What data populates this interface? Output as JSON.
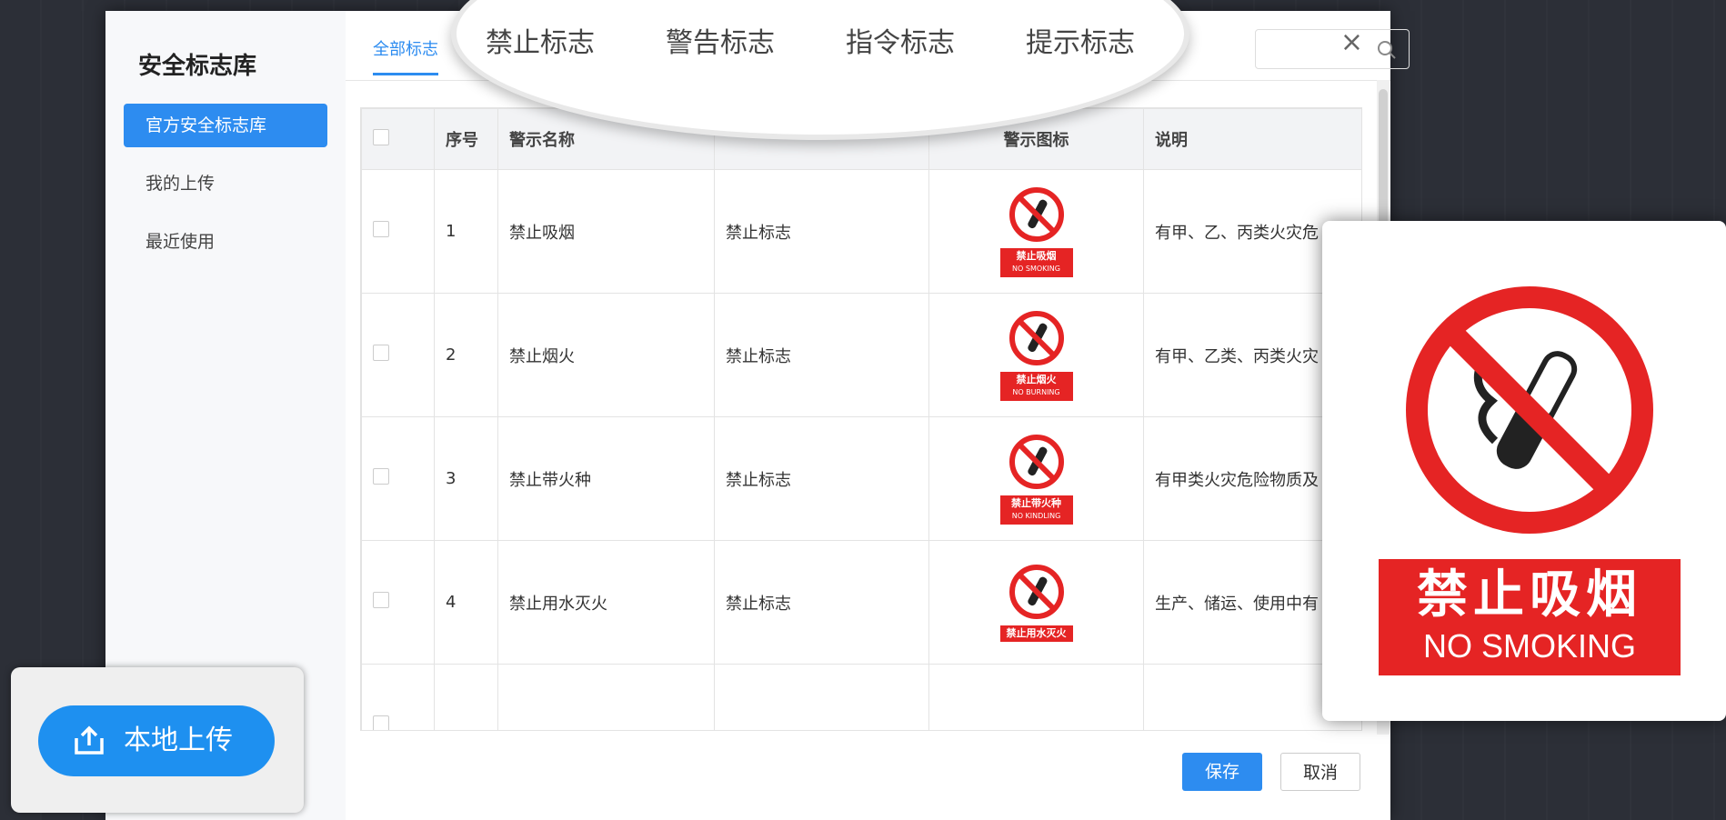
{
  "sidebar": {
    "title": "安全标志库",
    "items": [
      {
        "label": "官方安全标志库",
        "active": true
      },
      {
        "label": "我的上传",
        "active": false
      },
      {
        "label": "最近使用",
        "active": false
      }
    ]
  },
  "tabs": {
    "all_label": "全部标志"
  },
  "tab_zoom": {
    "labels": [
      "禁止标志",
      "警告标志",
      "指令标志",
      "提示标志"
    ]
  },
  "table": {
    "headers": [
      "序号",
      "警示名称",
      "",
      "警示图标",
      "说明"
    ],
    "rows": [
      {
        "no": "1",
        "name": "禁止吸烟",
        "category": "禁止标志",
        "sign_cn": "禁止吸烟",
        "sign_en": "NO SMOKING",
        "desc": "有甲、乙、丙类火灾危"
      },
      {
        "no": "2",
        "name": "禁止烟火",
        "category": "禁止标志",
        "sign_cn": "禁止烟火",
        "sign_en": "NO BURNING",
        "desc": "有甲、乙类、丙类火灾"
      },
      {
        "no": "3",
        "name": "禁止带火种",
        "category": "禁止标志",
        "sign_cn": "禁止带火种",
        "sign_en": "NO KINDLING",
        "desc": "有甲类火灾危险物质及"
      },
      {
        "no": "4",
        "name": "禁止用水灭火",
        "category": "禁止标志",
        "sign_cn": "禁止用水灭火",
        "sign_en": "",
        "desc": "生产、储运、使用中有"
      }
    ]
  },
  "actions": {
    "save": "保存",
    "cancel": "取消"
  },
  "upload": {
    "label": "本地上传"
  },
  "zoom_sign": {
    "cn": "禁止吸烟",
    "en": "NO SMOKING"
  },
  "colors": {
    "accent": "#2d8cf0",
    "sign_red": "#e52424"
  },
  "icons": [
    "search-icon",
    "close-icon",
    "upload-icon",
    "no-smoking-sign-icon"
  ]
}
